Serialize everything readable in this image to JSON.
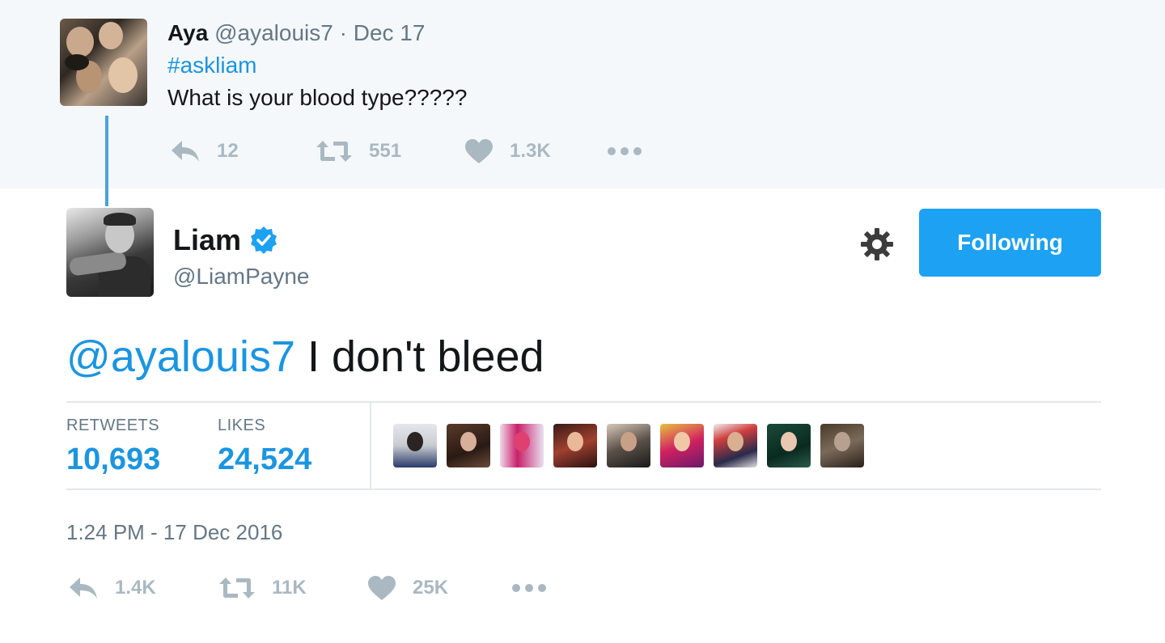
{
  "reply_context": {
    "name": "Aya",
    "handle": "@ayalouis7",
    "date_sep": "·",
    "date": "Dec 17",
    "hashtag": "#askliam",
    "text": "What is your blood type?????",
    "actions": {
      "reply_count": "12",
      "retweet_count": "551",
      "like_count": "1.3K"
    }
  },
  "tweet": {
    "name": "Liam",
    "verified": true,
    "handle": "@LiamPayne",
    "follow_label": "Following",
    "mention": "@ayalouis7",
    "text": " I don't bleed",
    "stats": {
      "retweets_label": "RETWEETS",
      "retweets": "10,693",
      "likes_label": "LIKES",
      "likes": "24,524"
    },
    "timestamp": "1:24 PM - 17 Dec 2016",
    "actions": {
      "reply_count": "1.4K",
      "retweet_count": "11K",
      "like_count": "25K"
    }
  },
  "colors": {
    "accent": "#1da1f2",
    "link": "#1b95e0",
    "muted": "#657786",
    "icon": "#aab8c2",
    "context_bg": "#f5f8fa",
    "thread_line": "#4ba3d9"
  },
  "icons": {
    "reply": "reply-icon",
    "retweet": "retweet-icon",
    "like": "heart-icon",
    "more": "more-icon",
    "settings": "gear-icon",
    "verified": "verified-badge-icon"
  }
}
